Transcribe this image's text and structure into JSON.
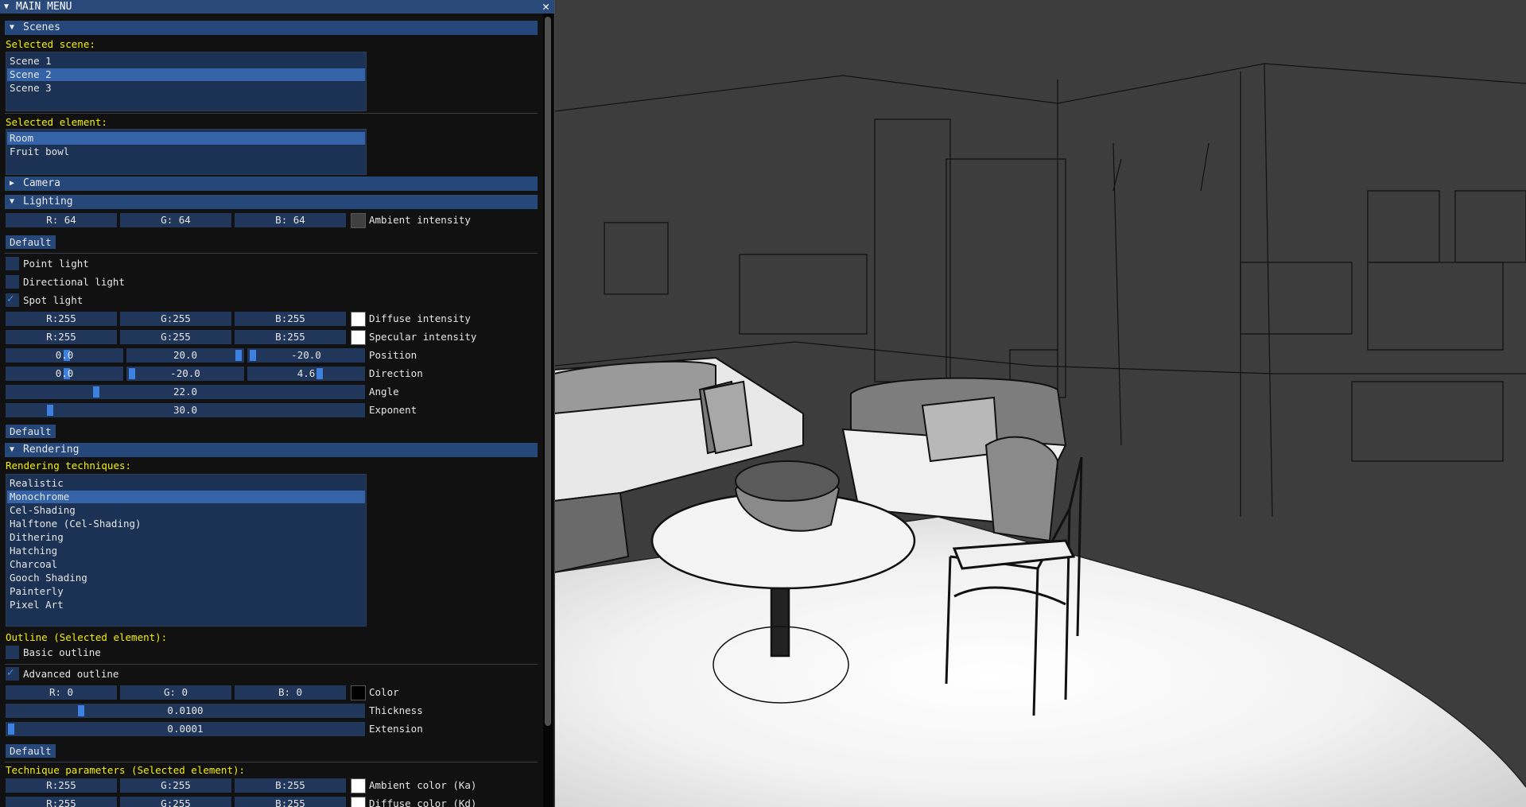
{
  "window": {
    "title": "MAIN MENU"
  },
  "scenes": {
    "header": "Scenes",
    "selected_scene_label": "Selected scene:",
    "items": [
      "Scene 1",
      "Scene 2",
      "Scene 3"
    ],
    "selected_index": 1,
    "selected_element_label": "Selected element:",
    "elements": [
      "Room",
      "Fruit bowl"
    ],
    "selected_element_index": 0
  },
  "camera": {
    "header": "Camera"
  },
  "lighting": {
    "header": "Lighting",
    "ambient": {
      "r": "R: 64",
      "g": "G: 64",
      "b": "B: 64",
      "label": "Ambient intensity",
      "color": "#404040"
    },
    "default_label": "Default",
    "point_light": {
      "label": "Point light",
      "checked": false
    },
    "directional_light": {
      "label": "Directional light",
      "checked": false
    },
    "spot_light": {
      "label": "Spot light",
      "checked": true
    },
    "diffuse": {
      "r": "R:255",
      "g": "G:255",
      "b": "B:255",
      "label": "Diffuse intensity",
      "color": "#ffffff"
    },
    "specular": {
      "r": "R:255",
      "g": "G:255",
      "b": "B:255",
      "label": "Specular intensity",
      "color": "#ffffff"
    },
    "position": {
      "x": "0.0",
      "y": "20.0",
      "z": "-20.0",
      "label": "Position"
    },
    "direction": {
      "x": "0.0",
      "y": "-20.0",
      "z": "4.6",
      "label": "Direction"
    },
    "angle": {
      "value": "22.0",
      "label": "Angle"
    },
    "exponent": {
      "value": "30.0",
      "label": "Exponent"
    },
    "default2_label": "Default"
  },
  "rendering": {
    "header": "Rendering",
    "techniques_label": "Rendering techniques:",
    "techniques": [
      "Realistic",
      "Monochrome",
      "Cel-Shading",
      "Halftone (Cel-Shading)",
      "Dithering",
      "Hatching",
      "Charcoal",
      "Gooch Shading",
      "Painterly",
      "Pixel Art"
    ],
    "selected_technique_index": 1,
    "outline_label": "Outline (Selected element):",
    "basic_outline": {
      "label": "Basic outline",
      "checked": false
    },
    "advanced_outline": {
      "label": "Advanced outline",
      "checked": true
    },
    "outline_color": {
      "r": "R:  0",
      "g": "G:  0",
      "b": "B:  0",
      "label": "Color",
      "color": "#000000"
    },
    "thickness": {
      "value": "0.0100",
      "label": "Thickness"
    },
    "extension": {
      "value": "0.0001",
      "label": "Extension"
    },
    "default_label": "Default",
    "params_label": "Technique parameters (Selected element):",
    "ambient_color": {
      "r": "R:255",
      "g": "G:255",
      "b": "B:255",
      "label": "Ambient color (Ka)",
      "color": "#ffffff"
    },
    "diffuse_color": {
      "r": "R:255",
      "g": "G:255",
      "b": "B:255",
      "label": "Diffuse color (Kd)",
      "color": "#ffffff"
    }
  }
}
